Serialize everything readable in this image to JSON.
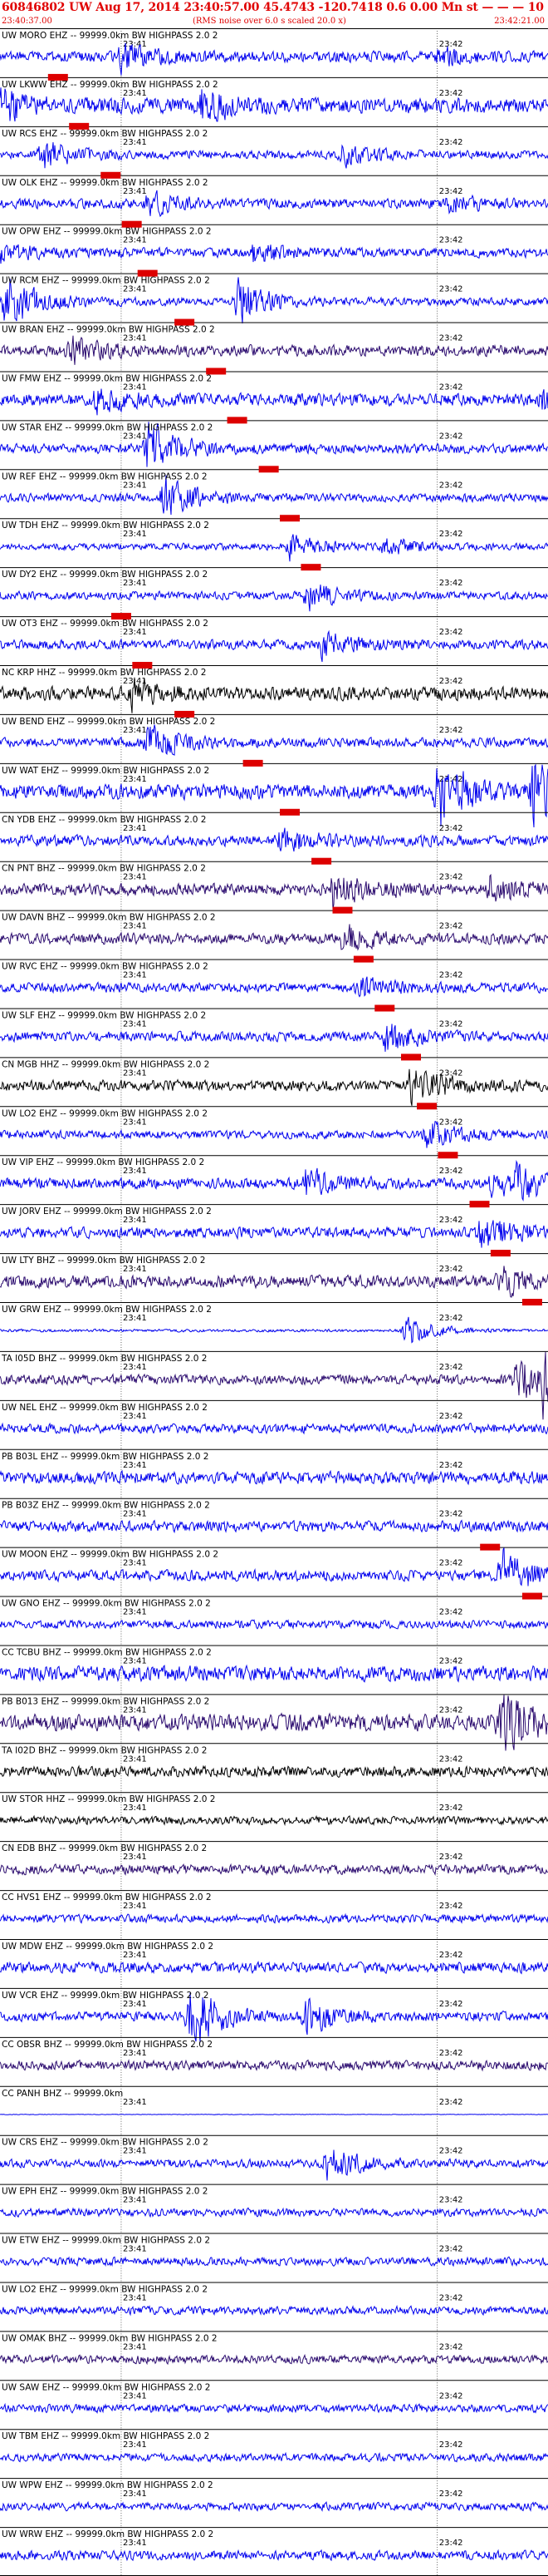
{
  "header": {
    "title": "60846802 UW Aug 17, 2014 23:40:57.00   45.4743 -120.7418  0.6 0.00 Mn st — — — 10",
    "start_time": "23:40:37.00",
    "note": "(RMS noise over 6.0 s scaled 20.0 x)",
    "end_time": "23:42:21.00"
  },
  "chart_data": {
    "type": "line",
    "title": "60846802 UW Aug 17, 2014 23:40:57.00   45.4743 -120.7418  0.6 0.00 Mn st — — — 10",
    "x_range": [
      "23:40:37.00",
      "23:42:21.00"
    ],
    "tick_labels": [
      "23:41",
      "23:42"
    ],
    "colors": {
      "blue": "#0000ee",
      "purple": "#2a0a6e",
      "black": "#000000",
      "pick": "#dd0000"
    },
    "traces": [
      {
        "label": "UW MORO EHZ -- 99999.0km BW  HIGHPASS  2.0  2",
        "color": "blue",
        "amp": 0.4,
        "events": [
          [
            23.41,
            0.9
          ],
          [
            23.42,
            0.55
          ]
        ],
        "pick": 23.4035
      },
      {
        "label": "UW LKWW EHZ -- 99999.0km BW  HIGHPASS  2.0  2",
        "color": "blue",
        "amp": 0.55,
        "events": [
          [
            23.4033,
            2.6
          ],
          [
            23.4075,
            1.2
          ]
        ],
        "pick": 23.4048
      },
      {
        "label": "UW RCS EHZ -- 99999.0km BW  HIGHPASS  2.0  2",
        "color": "blue",
        "amp": 0.3,
        "events": [
          [
            23.4045,
            1.1
          ],
          [
            23.4142,
            0.8
          ]
        ],
        "pick": 23.4052
      },
      {
        "label": "UW OLK EHZ -- 99999.0km BW  HIGHPASS  2.0  2",
        "color": "blue",
        "amp": 0.35,
        "events": [
          [
            23.4105,
            0.8
          ],
          [
            23.4162,
            0.6
          ]
        ],
        "pick": 23.4058
      },
      {
        "label": "UW OPW EHZ -- 99999.0km BW  HIGHPASS  2.0  2",
        "color": "blue",
        "amp": 0.35,
        "events": [
          [
            23.4032,
            1.8
          ],
          [
            23.4125,
            0.7
          ]
        ],
        "pick": 23.4062
      },
      {
        "label": "UW RCM EHZ -- 99999.0km BW  HIGHPASS  2.0  2",
        "color": "blue",
        "amp": 0.3,
        "events": [
          [
            23.4038,
            2.2
          ],
          [
            23.4122,
            1.8
          ]
        ],
        "pick": 23.4065
      },
      {
        "label": "UW BRAN EHZ -- 99999.0km BW  HIGHPASS  2.0  2",
        "color": "purple",
        "amp": 0.4,
        "events": [
          [
            23.405,
            0.9
          ]
        ],
        "pick": 23.4072
      },
      {
        "label": "UW FMW EHZ -- 99999.0km BW  HIGHPASS  2.0  2",
        "color": "blue",
        "amp": 0.45,
        "events": [
          [
            23.4055,
            0.9
          ],
          [
            23.418,
            0.6
          ]
        ],
        "pick": 23.4078
      },
      {
        "label": "UW STAR EHZ -- 99999.0km BW  HIGHPASS  2.0  2",
        "color": "blue",
        "amp": 0.35,
        "events": [
          [
            23.4065,
            2.0
          ]
        ],
        "pick": 23.4082
      },
      {
        "label": "UW REF EHZ -- 99999.0km BW  HIGHPASS  2.0  2",
        "color": "blue",
        "amp": 0.3,
        "events": [
          [
            23.4068,
            1.6
          ]
        ],
        "pick": 23.4088
      },
      {
        "label": "UW TDH EHZ -- 99999.0km BW  HIGHPASS  2.0  2",
        "color": "blue",
        "amp": 0.25,
        "events": [
          [
            23.4092,
            0.9
          ],
          [
            23.415,
            0.7
          ]
        ],
        "pick": 23.4092
      },
      {
        "label": "UW DY2 EHZ -- 99999.0km BW  HIGHPASS  2.0  2",
        "color": "blue",
        "amp": 0.3,
        "events": [
          [
            23.4095,
            1.0
          ]
        ],
        "pick": 23.4096
      },
      {
        "label": "UW OT3 EHZ -- 99999.0km BW  HIGHPASS  2.0  2",
        "color": "blue",
        "amp": 0.35,
        "events": [
          [
            23.4098,
            0.9
          ]
        ],
        "pick": 23.41
      },
      {
        "label": "NC KRP HHZ -- 99999.0km BW  HIGHPASS  2.0  2",
        "color": "black",
        "amp": 0.5,
        "events": [
          [
            23.4102,
            0.9
          ]
        ],
        "pick": 23.4104
      },
      {
        "label": "UW BEND EHZ -- 99999.0km BW  HIGHPASS  2.0  2",
        "color": "blue",
        "amp": 0.35,
        "events": [
          [
            23.4105,
            1.3
          ]
        ],
        "pick": 23.4112
      },
      {
        "label": "UW WAT EHZ -- 99999.0km BW  HIGHPASS  2.0  2",
        "color": "blue",
        "amp": 0.55,
        "events": [
          [
            23.416,
            2.6
          ],
          [
            23.4178,
            2.6
          ],
          [
            23.4195,
            2.4
          ]
        ],
        "pick": 23.4125
      },
      {
        "label": "CN YDB EHZ -- 99999.0km BW  HIGHPASS  2.0  2",
        "color": "blue",
        "amp": 0.4,
        "events": [
          [
            23.413,
            0.9
          ]
        ],
        "pick": 23.4132
      },
      {
        "label": "CN PNT BHZ -- 99999.0km BW  HIGHPASS  2.0  2",
        "color": "purple",
        "amp": 0.45,
        "events": [
          [
            23.414,
            1.4
          ],
          [
            23.417,
            0.9
          ]
        ],
        "pick": 23.4138
      },
      {
        "label": "UW DAVN BHZ -- 99999.0km BW  HIGHPASS  2.0  2",
        "color": "purple",
        "amp": 0.4,
        "events": [
          [
            23.4142,
            0.9
          ]
        ],
        "pick": 23.4142
      },
      {
        "label": "UW RVC EHZ -- 99999.0km BW  HIGHPASS  2.0  2",
        "color": "blue",
        "amp": 0.35,
        "events": [
          [
            23.4145,
            0.8
          ]
        ],
        "pick": 23.4146
      },
      {
        "label": "UW SLF EHZ -- 99999.0km BW  HIGHPASS  2.0  2",
        "color": "blue",
        "amp": 0.35,
        "events": [
          [
            23.415,
            1.2
          ]
        ],
        "pick": 23.415
      },
      {
        "label": "CN MGB HHZ -- 99999.0km BW  HIGHPASS  2.0  2",
        "color": "black",
        "amp": 0.4,
        "events": [
          [
            23.4155,
            1.6
          ]
        ],
        "pick": 23.4155
      },
      {
        "label": "UW LO2 EHZ -- 99999.0km BW  HIGHPASS  2.0  2",
        "color": "blue",
        "amp": 0.3,
        "events": [
          [
            23.4158,
            1.0
          ]
        ],
        "pick": 23.4158
      },
      {
        "label": "UW VIP EHZ -- 99999.0km BW  HIGHPASS  2.0  2",
        "color": "blue",
        "amp": 0.4,
        "events": [
          [
            23.4135,
            1.0
          ],
          [
            23.4175,
            1.1
          ],
          [
            23.421,
            0.9
          ]
        ],
        "pick": 23.4162
      },
      {
        "label": "UW JORV EHZ -- 99999.0km BW  HIGHPASS  2.0  2",
        "color": "blue",
        "amp": 0.4,
        "events": [
          [
            23.4168,
            1.3
          ]
        ],
        "pick": 23.4168
      },
      {
        "label": "UW LTY BHZ -- 99999.0km BW  HIGHPASS  2.0  2",
        "color": "purple",
        "amp": 0.45,
        "events": [
          [
            23.4172,
            0.9
          ]
        ],
        "pick": 23.4172
      },
      {
        "label": "UW GRW EHZ -- 99999.0km BW  HIGHPASS  2.0  2",
        "color": "blue",
        "amp": 0.1,
        "events": [
          [
            23.4154,
            1.2
          ]
        ],
        "pick": 23.4178
      },
      {
        "label": "TA I05D BHZ -- 99999.0km BW  HIGHPASS  2.0  2",
        "color": "purple",
        "amp": 0.35,
        "events": [
          [
            23.418,
            2.2
          ],
          [
            23.4215,
            1.6
          ]
        ],
        "pick": 23.4183
      },
      {
        "label": "UW NEL EHZ -- 99999.0km BW  HIGHPASS  2.0  2",
        "color": "blue",
        "amp": 0.35,
        "events": [
          [
            23.419,
            1.1
          ]
        ],
        "pick": 23.4188
      },
      {
        "label": "PB B03L EHZ -- 99999.0km BW  HIGHPASS  2.0  2",
        "color": "blue",
        "amp": 0.45,
        "events": [
          [
            23.4192,
            0.9
          ]
        ],
        "pick": 23.4192
      },
      {
        "label": "PB B03Z EHZ -- 99999.0km BW  HIGHPASS  2.0  2",
        "color": "blue",
        "amp": 0.4,
        "events": [
          [
            23.4198,
            1.0
          ]
        ],
        "pick": 23.4198
      },
      {
        "label": "UW MOON EHZ -- 99999.0km BW  HIGHPASS  2.0  2",
        "color": "blue",
        "amp": 0.4,
        "events": [
          [
            23.4212,
            1.8
          ],
          [
            23.4222,
            2.0
          ]
        ],
        "pick": 23.421
      },
      {
        "label": "UW GNO EHZ -- 99999.0km BW  HIGHPASS  2.0  2",
        "color": "blue",
        "amp": 0.3,
        "events": [
          [
            23.4222,
            1.1
          ]
        ],
        "pick": 23.4218
      },
      {
        "label": "CC TCBU BHZ -- 99999.0km BW  HIGHPASS  2.0  2",
        "color": "blue",
        "amp": 0.55,
        "events": [
          [
            23.4226,
            1.0
          ]
        ],
        "pick": 23.4224
      },
      {
        "label": "PB B013 EHZ -- 99999.0km BW  HIGHPASS  2.0  2",
        "color": "purple",
        "amp": 0.6,
        "events": [
          [
            23.4212,
            2.4
          ],
          [
            23.4232,
            2.4
          ]
        ],
        "pick": 23.423
      },
      {
        "label": "TA I02D BHZ -- 99999.0km BW  HIGHPASS  2.0  2",
        "color": "black",
        "amp": 0.4,
        "events": [
          [
            23.4236,
            1.3
          ]
        ],
        "pick": 23.4236
      },
      {
        "label": "UW STOR HHZ -- 99999.0km BW  HIGHPASS  2.0  2",
        "color": "black",
        "amp": 0.3,
        "events": [
          [
            23.424,
            0.9
          ]
        ],
        "pick": 23.424
      },
      {
        "label": "CN EDB BHZ -- 99999.0km BW  HIGHPASS  2.0  2",
        "color": "purple",
        "amp": 0.35,
        "events": [
          [
            23.4244,
            0.8
          ]
        ],
        "pick": 23.4244
      },
      {
        "label": "CC HVS1 EHZ -- 99999.0km BW  HIGHPASS  2.0  2",
        "color": "blue",
        "amp": 0.3,
        "events": [
          [
            23.4252,
            1.5
          ]
        ],
        "pick": 23.425
      },
      {
        "label": "UW MDW EHZ -- 99999.0km BW  HIGHPASS  2.0  2",
        "color": "blue",
        "amp": 0.4,
        "events": [
          [
            23.4262,
            0.9
          ]
        ],
        "pick": 23.4262
      },
      {
        "label": "UW VCR EHZ -- 99999.0km BW  HIGHPASS  2.0  2",
        "color": "blue",
        "amp": 0.35,
        "events": [
          [
            23.4073,
            2.4
          ],
          [
            23.4095,
            1.2
          ]
        ],
        "pick": 23.4268
      },
      {
        "label": "CC OBSR BHZ -- 99999.0km BW  HIGHPASS  2.0  2",
        "color": "purple",
        "amp": 0.35,
        "events": [],
        "pick": null
      },
      {
        "label": "CC PANH BHZ -- 99999.0km",
        "color": "blue",
        "amp": 0.02,
        "events": [],
        "pick": null
      },
      {
        "label": "UW CRS EHZ -- 99999.0km BW  HIGHPASS  2.0  2",
        "color": "blue",
        "amp": 0.3,
        "events": [
          [
            23.4099,
            1.3
          ]
        ],
        "pick": null
      },
      {
        "label": "UW EPH EHZ -- 99999.0km BW  HIGHPASS  2.0  2",
        "color": "blue",
        "amp": 0.3,
        "events": [],
        "pick": null
      },
      {
        "label": "UW ETW EHZ -- 99999.0km BW  HIGHPASS  2.0  2",
        "color": "blue",
        "amp": 0.3,
        "events": [],
        "pick": null
      },
      {
        "label": "UW LO2 EHZ -- 99999.0km BW  HIGHPASS  2.0  2",
        "color": "blue",
        "amp": 0.3,
        "events": [],
        "pick": null
      },
      {
        "label": "UW OMAK BHZ -- 99999.0km BW  HIGHPASS  2.0  2",
        "color": "purple",
        "amp": 0.3,
        "events": [],
        "pick": null
      },
      {
        "label": "UW SAW EHZ -- 99999.0km BW  HIGHPASS  2.0  2",
        "color": "blue",
        "amp": 0.3,
        "events": [],
        "pick": null
      },
      {
        "label": "UW TBM EHZ -- 99999.0km BW  HIGHPASS  2.0  2",
        "color": "blue",
        "amp": 0.3,
        "events": [],
        "pick": null
      },
      {
        "label": "UW WPW EHZ -- 99999.0km BW  HIGHPASS  2.0  2",
        "color": "blue",
        "amp": 0.3,
        "events": [],
        "pick": null
      },
      {
        "label": "UW WRW EHZ -- 99999.0km BW  HIGHPASS  2.0  2",
        "color": "blue",
        "amp": 0.35,
        "events": [],
        "pick": null
      }
    ]
  }
}
